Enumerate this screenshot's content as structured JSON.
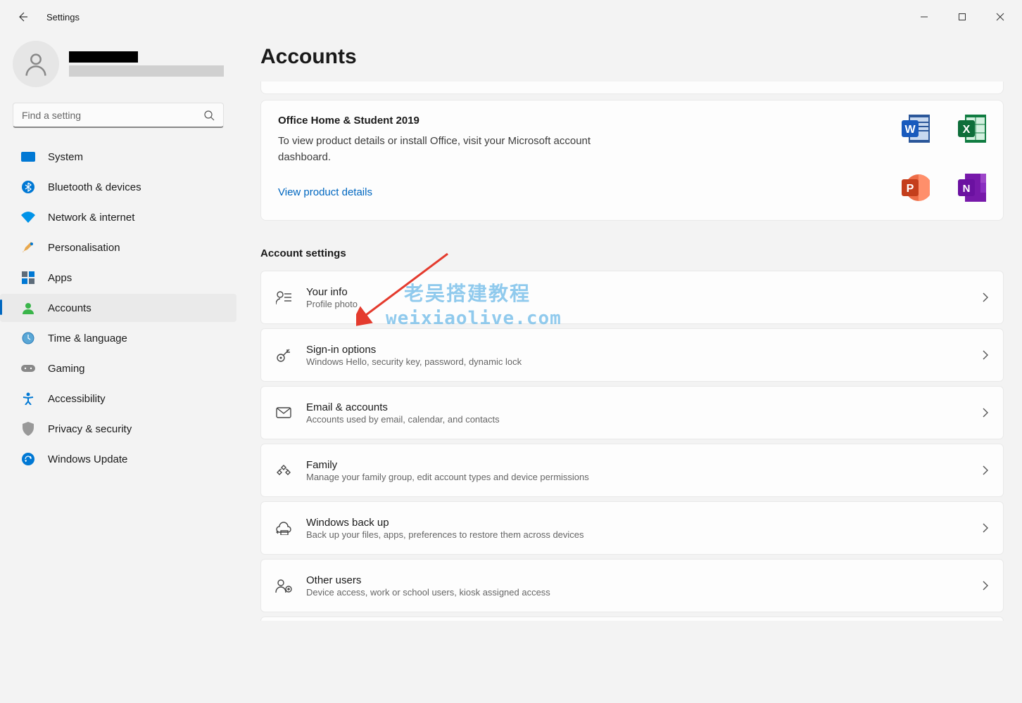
{
  "window": {
    "title": "Settings"
  },
  "search": {
    "placeholder": "Find a setting"
  },
  "sidebar": {
    "items": [
      {
        "label": "System"
      },
      {
        "label": "Bluetooth & devices"
      },
      {
        "label": "Network & internet"
      },
      {
        "label": "Personalisation"
      },
      {
        "label": "Apps"
      },
      {
        "label": "Accounts"
      },
      {
        "label": "Time & language"
      },
      {
        "label": "Gaming"
      },
      {
        "label": "Accessibility"
      },
      {
        "label": "Privacy & security"
      },
      {
        "label": "Windows Update"
      }
    ]
  },
  "page": {
    "title": "Accounts"
  },
  "office": {
    "heading": "Office Home & Student 2019",
    "desc": "To view product details or install Office, visit your Microsoft account dashboard.",
    "link": "View product details"
  },
  "accountSettings": {
    "label": "Account settings",
    "rows": [
      {
        "title": "Your info",
        "sub": "Profile photo"
      },
      {
        "title": "Sign-in options",
        "sub": "Windows Hello, security key, password, dynamic lock"
      },
      {
        "title": "Email & accounts",
        "sub": "Accounts used by email, calendar, and contacts"
      },
      {
        "title": "Family",
        "sub": "Manage your family group, edit account types and device permissions"
      },
      {
        "title": "Windows back up",
        "sub": "Back up your files, apps, preferences to restore them across devices"
      },
      {
        "title": "Other users",
        "sub": "Device access, work or school users, kiosk assigned access"
      }
    ]
  },
  "watermark": {
    "line1": "老吴搭建教程",
    "line2": "weixiaolive.com"
  }
}
